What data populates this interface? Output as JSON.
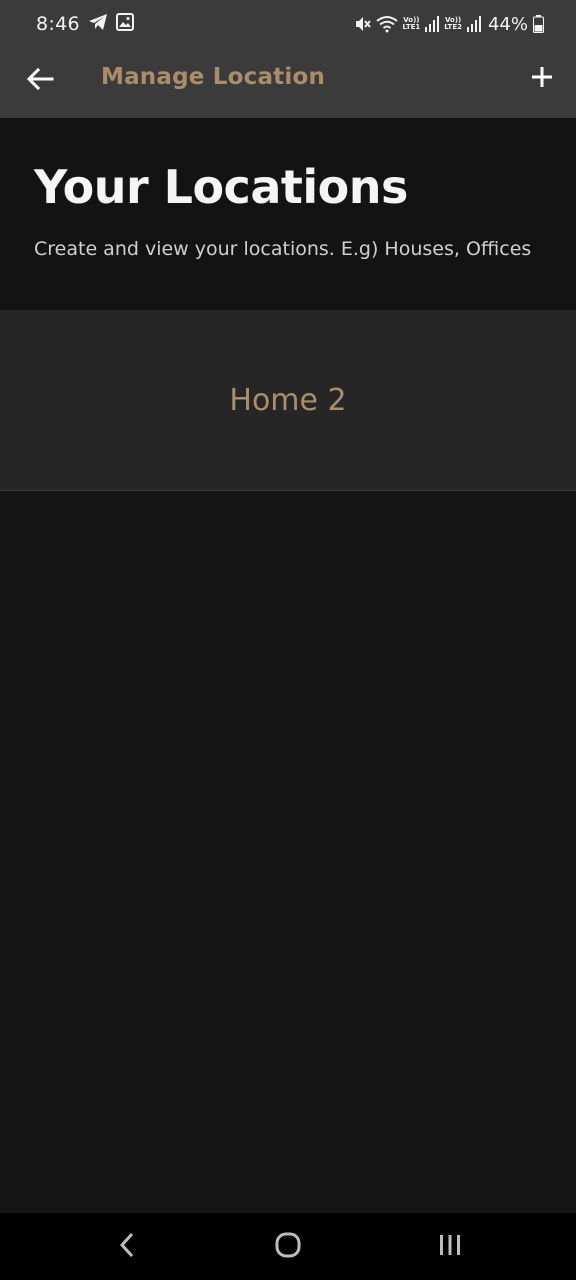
{
  "status_bar": {
    "time": "8:46",
    "battery": "44%",
    "lte1": "LTE1",
    "lte2": "LTE2",
    "icons": [
      "telegram-icon",
      "gallery-icon",
      "mute-icon",
      "wifi-icon",
      "signal-icon",
      "battery-icon"
    ]
  },
  "app_bar": {
    "title": "Manage Location",
    "back_icon": "arrow-left-icon",
    "add_icon": "plus-icon"
  },
  "header": {
    "title": "Your Locations",
    "subtitle": "Create and view your locations. E.g) Houses, Offices"
  },
  "locations": [
    {
      "name": "Home 2"
    }
  ],
  "nav_bar": {
    "icons": [
      "back-nav-icon",
      "home-nav-icon",
      "recents-nav-icon"
    ]
  },
  "colors": {
    "accent": "#a88f69",
    "app_bar": "#3b3b3b",
    "background": "#151515",
    "list_item": "#262626"
  }
}
